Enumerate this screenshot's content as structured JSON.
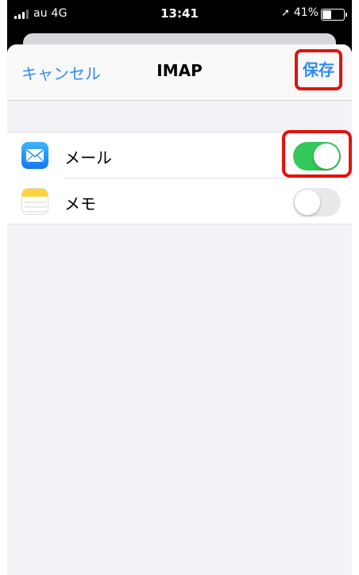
{
  "status_bar": {
    "carrier": "au  4G",
    "time": "13:41",
    "battery_percent": "41%",
    "battery_level": 0.41,
    "icons": [
      "signal-icon",
      "location-arrow-icon",
      "battery-icon"
    ]
  },
  "nav": {
    "cancel_label": "キャンセル",
    "title": "IMAP",
    "save_label": "保存"
  },
  "list": {
    "items": [
      {
        "label": "メール",
        "icon": "mail-app-icon",
        "enabled": true
      },
      {
        "label": "メモ",
        "icon": "notes-app-icon",
        "enabled": false
      }
    ]
  },
  "colors": {
    "accent_blue": "#2f8cf3",
    "toggle_on": "#34c759",
    "toggle_off": "#e9e9eb",
    "highlight_red": "#e3120b",
    "grouped_background": "#f2f2f7"
  }
}
